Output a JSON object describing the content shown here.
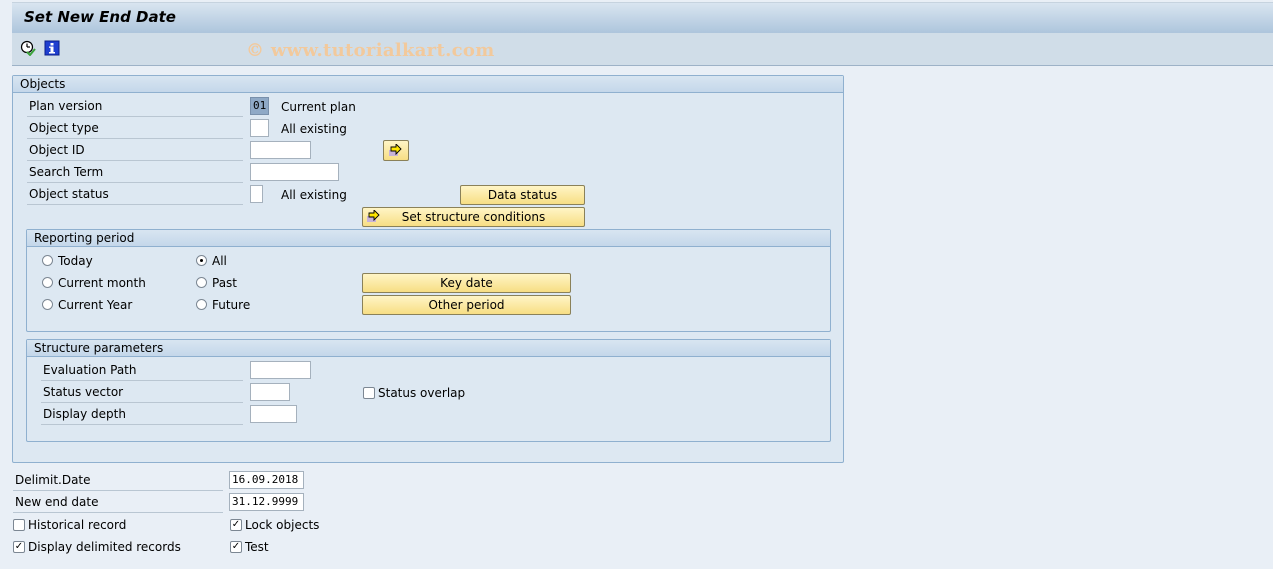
{
  "window": {
    "title": "Set New End Date",
    "watermark": "© www.tutorialkart.com"
  },
  "toolbar": {
    "execute_icon": "clock-check-icon",
    "info_icon": "info-icon"
  },
  "objects": {
    "header": "Objects",
    "plan_version": {
      "label": "Plan version",
      "value": "01",
      "text": "Current plan"
    },
    "object_type": {
      "label": "Object type",
      "value": "",
      "text": "All existing"
    },
    "object_id": {
      "label": "Object ID",
      "value": ""
    },
    "search_term": {
      "label": "Search Term",
      "value": ""
    },
    "object_status": {
      "label": "Object status",
      "value": "",
      "text": "All existing"
    },
    "data_status_button": "Data status",
    "set_structure_button": "Set structure conditions",
    "reporting_period": {
      "header": "Reporting period",
      "radios": [
        {
          "label": "Today",
          "selected": false
        },
        {
          "label": "Current month",
          "selected": false
        },
        {
          "label": "Current Year",
          "selected": false
        },
        {
          "label": "All",
          "selected": true
        },
        {
          "label": "Past",
          "selected": false
        },
        {
          "label": "Future",
          "selected": false
        }
      ],
      "key_date_button": "Key date",
      "other_period_button": "Other period"
    },
    "structure_parameters": {
      "header": "Structure parameters",
      "evaluation_path": {
        "label": "Evaluation Path",
        "value": ""
      },
      "status_vector": {
        "label": "Status vector",
        "value": ""
      },
      "display_depth": {
        "label": "Display depth",
        "value": ""
      },
      "status_overlap": {
        "label": "Status overlap",
        "checked": false
      }
    }
  },
  "bottom": {
    "delimit_date": {
      "label": "Delimit.Date",
      "value": "16.09.2018"
    },
    "new_end_date": {
      "label": "New end date",
      "value": "31.12.9999"
    },
    "historical_record": {
      "label": "Historical record",
      "checked": false
    },
    "display_delimited": {
      "label": "Display delimited records",
      "checked": true
    },
    "lock_objects": {
      "label": "Lock objects",
      "checked": true
    },
    "test": {
      "label": "Test",
      "checked": true
    }
  }
}
